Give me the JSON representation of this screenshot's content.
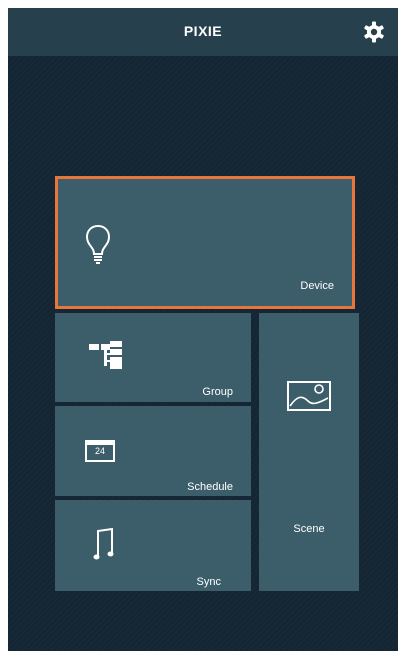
{
  "header": {
    "title": "PIXIE",
    "settings_icon": "gear-icon"
  },
  "tiles": {
    "device": {
      "label": "Device",
      "icon": "lightbulb-icon",
      "selected": true,
      "border_color": "#e8763b"
    },
    "group": {
      "label": "Group",
      "icon": "hierarchy-icon"
    },
    "schedule": {
      "label": "Schedule",
      "icon": "calendar-icon",
      "calendar_number": "24"
    },
    "sync": {
      "label": "Sync",
      "icon": "music-note-icon"
    },
    "scene": {
      "label": "Scene",
      "icon": "image-icon"
    }
  },
  "colors": {
    "background": "#142533",
    "header": "#27404e",
    "tile": "#3c5d6a",
    "accent": "#e8763b",
    "text": "#ffffff"
  }
}
